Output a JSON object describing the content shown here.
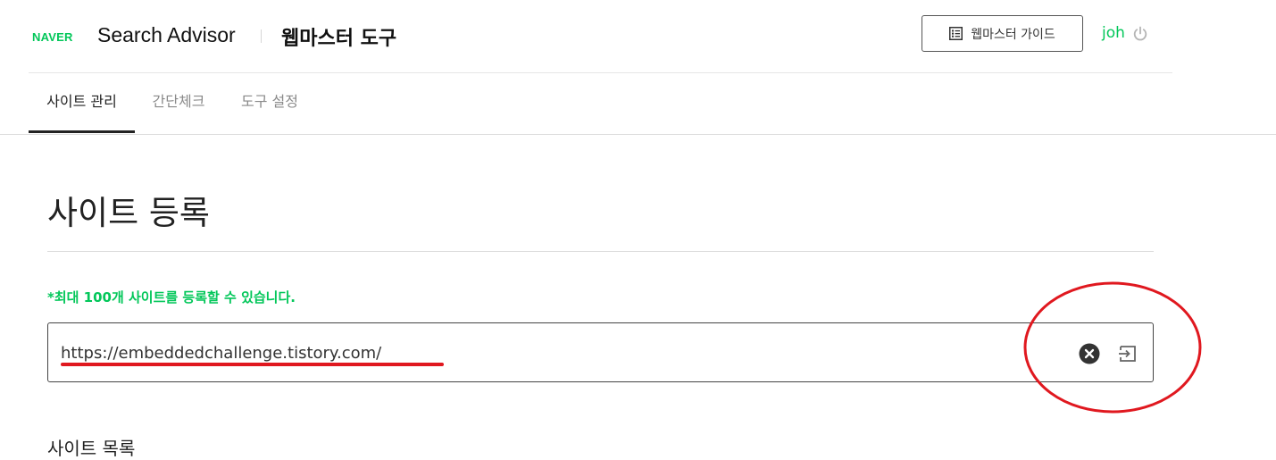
{
  "header": {
    "logo": "NAVER",
    "product": "Search Advisor",
    "tool_title": "웹마스터 도구",
    "guide_label": "웹마스터 가이드",
    "user_name": "joh"
  },
  "tabs": [
    {
      "label": "사이트 관리",
      "active": true
    },
    {
      "label": "간단체크",
      "active": false
    },
    {
      "label": "도구 설정",
      "active": false
    }
  ],
  "main": {
    "title": "사이트 등록",
    "notice": "*최대 100개 사이트를 등록할 수 있습니다.",
    "url_value": "https://embeddedchallenge.tistory.com/",
    "section_label": "사이트 목록"
  },
  "colors": {
    "brand_green": "#03c75a",
    "annotation_red": "#e0181f"
  },
  "icons": {
    "guide": "list-doc-icon",
    "logout": "power-icon",
    "clear": "clear-x-circle-icon",
    "submit": "enter-arrow-icon"
  }
}
